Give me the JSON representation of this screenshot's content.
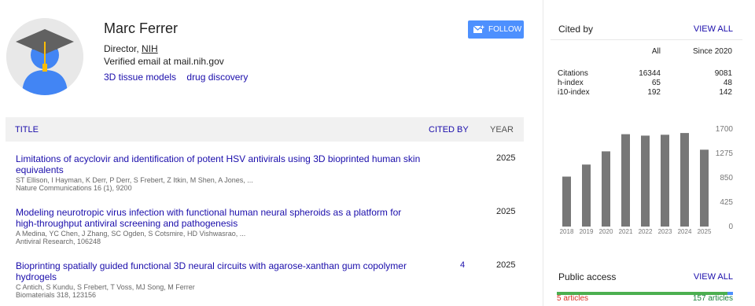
{
  "profile": {
    "name": "Marc Ferrer",
    "role_prefix": "Director, ",
    "institution": "NIH",
    "email": "Verified email at mail.nih.gov",
    "interests": [
      "3D tissue models",
      "drug discovery"
    ],
    "follow_label": "FOLLOW"
  },
  "table": {
    "headers": {
      "title": "TITLE",
      "cited_by": "CITED BY",
      "year": "YEAR"
    },
    "rows": [
      {
        "title": "Limitations of acyclovir and identification of potent HSV antivirals using 3D bioprinted human skin equivalents",
        "authors": "ST Ellison, I Hayman, K Derr, P Derr, S Frebert, Z Itkin, M Shen, A Jones, ...",
        "venue": "Nature Communications 16 (1), 9200",
        "cited_by": "",
        "year": "2025"
      },
      {
        "title": "Modeling neurotropic virus infection with functional human neural spheroids as a platform for high-throughput antiviral screening and pathogenesis",
        "authors": "A Medina, YC Chen, J Zhang, SC Ogden, S Cotsmire, HD Vishwasrao, ...",
        "venue": "Antiviral Research, 106248",
        "cited_by": "",
        "year": "2025"
      },
      {
        "title": "Bioprinting spatially guided functional 3D neural circuits with agarose-xanthan gum copolymer hydrogels",
        "authors": "C Antich, S Kundu, S Frebert, T Voss, MJ Song, M Ferrer",
        "venue": "Biomaterials 318, 123156",
        "cited_by": "4",
        "year": "2025"
      }
    ]
  },
  "sidebar": {
    "cited_by_title": "Cited by",
    "view_all_label": "VIEW ALL",
    "stats_headers": [
      "All",
      "Since 2020"
    ],
    "stats": [
      {
        "label": "Citations",
        "all": "16344",
        "since": "9081"
      },
      {
        "label": "h-index",
        "all": "65",
        "since": "48"
      },
      {
        "label": "i10-index",
        "all": "192",
        "since": "142"
      }
    ],
    "public_access_title": "Public access",
    "public_access_view_all": "VIEW ALL",
    "not_available": "5 articles",
    "available": "157 articles",
    "available_fraction": 0.969,
    "colors": {
      "bar": "#777777",
      "link": "#1a0dab",
      "not_available": "#d93025",
      "available": "#188038",
      "access_bar_available": "#4caf50",
      "access_bar_total": "#4d90fe"
    }
  },
  "chart_data": {
    "type": "bar",
    "categories": [
      "2018",
      "2019",
      "2020",
      "2021",
      "2022",
      "2023",
      "2024",
      "2025"
    ],
    "values": [
      870,
      1080,
      1310,
      1610,
      1585,
      1600,
      1630,
      1340
    ],
    "y_ticks": [
      "0",
      "425",
      "850",
      "1275",
      "1700"
    ],
    "ylim": [
      0,
      1700
    ],
    "grid": false,
    "title": "",
    "xlabel": "",
    "ylabel": ""
  }
}
